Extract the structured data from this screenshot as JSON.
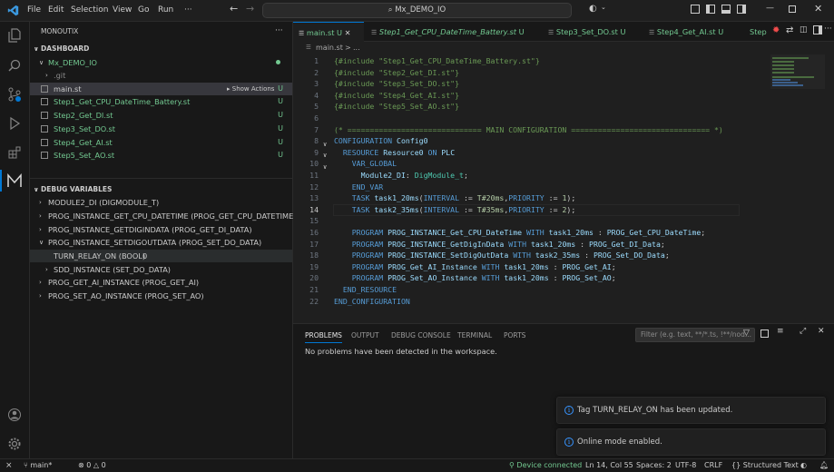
{
  "titlebar": {
    "menus": [
      "File",
      "Edit",
      "Selection",
      "View",
      "Go",
      "Run",
      "···"
    ],
    "search_text": "Mx_DEMO_IO"
  },
  "sidebar": {
    "title": "MONOUTIX",
    "dashboard_header": "DASHBOARD",
    "project": "Mx_DEMO_IO",
    "files": [
      {
        "name": ".git",
        "badge": ""
      },
      {
        "name": "main.st",
        "badge": "U",
        "action": "Show Actions"
      },
      {
        "name": "Step1_Get_CPU_DateTime_Battery.st",
        "badge": "U"
      },
      {
        "name": "Step2_Get_DI.st",
        "badge": "U"
      },
      {
        "name": "Step3_Set_DO.st",
        "badge": "U"
      },
      {
        "name": "Step4_Get_AI.st",
        "badge": "U"
      },
      {
        "name": "Step5_Set_AO.st",
        "badge": "U"
      }
    ],
    "debug_header": "DEBUG VARIABLES",
    "debug_vars": [
      "MODULE2_DI (DIGMODULE_T)",
      "PROG_INSTANCE_GET_CPU_DATETIME (PROG_GET_CPU_DATETIME)",
      "PROG_INSTANCE_GETDIGINDATA (PROG_GET_DI_DATA)",
      "PROG_INSTANCE_SETDIGOUTDATA (PROG_SET_DO_DATA)",
      "TURN_RELAY_ON (BOOL)",
      "SDD_INSTANCE (SET_DO_DATA)",
      "PROG_GET_AI_INSTANCE (PROG_GET_AI)",
      "PROG_SET_AO_INSTANCE (PROG_SET_AO)"
    ],
    "relay_value": "0"
  },
  "tabs": [
    {
      "label": "main.st",
      "badge": "U"
    },
    {
      "label": "Step1_Get_CPU_DateTime_Battery.st",
      "badge": "U"
    },
    {
      "label": "Step3_Set_DO.st",
      "badge": "U"
    },
    {
      "label": "Step4_Get_AI.st",
      "badge": "U"
    },
    {
      "label": "Step",
      "badge": ""
    }
  ],
  "breadcrumbs": {
    "file": "main.st",
    "sep": ">",
    "more": "..."
  },
  "code_lines": [
    "{#include \"Step1_Get_CPU_DateTime_Battery.st\"}",
    "{#include \"Step2_Get_DI.st\"}",
    "{#include \"Step3_Set_DO.st\"}",
    "{#include \"Step4_Get_AI.st\"}",
    "{#include \"Step5_Set_AO.st\"}",
    "",
    "(* ============================== MAIN CONFIGURATION =============================== *)",
    "CONFIGURATION Config0",
    "  RESOURCE Resource0 ON PLC",
    "    VAR_GLOBAL",
    "      Module2_DI: DigModule_t;",
    "    END_VAR",
    "    TASK task1_20ms(INTERVAL := T#20ms,PRIORITY := 1);",
    "    TASK task2_35ms(INTERVAL := T#35ms,PRIORITY := 2);",
    "",
    "    PROGRAM PROG_INSTANCE_Get_CPU_DateTime WITH task1_20ms : PROG_Get_CPU_DateTime;",
    "    PROGRAM PROG_INSTANCE_GetDigInData WITH task1_20ms : PROG_Get_DI_Data;",
    "    PROGRAM PROG_INSTANCE_SetDigOutData WITH task2_35ms : PROG_Set_DO_Data;",
    "    PROGRAM PROG_Get_AI_Instance WITH task1_20ms : PROG_Get_AI;",
    "    PROGRAM PROG_Set_AO_Instance WITH task1_20ms : PROG_Set_AO;",
    "  END_RESOURCE",
    "END_CONFIGURATION"
  ],
  "line_numbers": [
    "1",
    "2",
    "3",
    "4",
    "5",
    "6",
    "7",
    "8",
    "9",
    "10",
    "11",
    "12",
    "13",
    "14",
    "15",
    "16",
    "17",
    "18",
    "19",
    "20",
    "21",
    "22"
  ],
  "panel": {
    "tabs": [
      "PROBLEMS",
      "OUTPUT",
      "DEBUG CONSOLE",
      "TERMINAL",
      "PORTS"
    ],
    "filter_placeholder": "Filter (e.g. text, **/*.ts, !**/nod...",
    "message": "No problems have been detected in the workspace."
  },
  "notifications": [
    "Tag TURN_RELAY_ON has been updated.",
    "Online mode enabled."
  ],
  "statusbar": {
    "branch": "main*",
    "errors": "0",
    "warnings": "0",
    "device": "Device connected",
    "position": "Ln 14, Col 55",
    "spaces": "Spaces: 2",
    "encoding": "UTF-8",
    "eol": "CRLF",
    "language": "Structured Text"
  },
  "colors": {
    "accent": "#0078d4",
    "untracked": "#73c991",
    "comment": "#6a9955",
    "keyword": "#569cd6"
  }
}
